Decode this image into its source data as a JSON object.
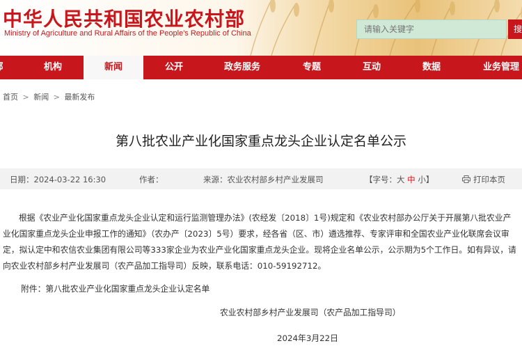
{
  "header": {
    "title_cn": "中华人民共和国农业农村部",
    "title_en": "Ministry of Agriculture and Rural Affairs of the People's Republic of China",
    "search_placeholder": "请输入关键字",
    "search_button": "搜"
  },
  "nav": {
    "items": [
      {
        "label": "部",
        "active": false
      },
      {
        "label": "机构",
        "active": false
      },
      {
        "label": "新闻",
        "active": true
      },
      {
        "label": "公开",
        "active": false
      },
      {
        "label": "政务服务",
        "active": false
      },
      {
        "label": "专题",
        "active": false
      },
      {
        "label": "互动",
        "active": false
      },
      {
        "label": "数据",
        "active": false
      },
      {
        "label": "业务管理",
        "active": false
      }
    ]
  },
  "breadcrumb": {
    "items": [
      "首页",
      "新闻",
      "最新发布"
    ],
    "separator": ">"
  },
  "article": {
    "title": "第八批农业产业化国家重点龙头企业认定名单公示",
    "date": "日期：2024-03-22 16:30",
    "author": "作者：",
    "source": "来源：农业农村部乡村产业发展司",
    "font_size_prefix": "【字号：",
    "font_large": "大",
    "font_medium": "中",
    "font_small": "小",
    "font_size_suffix": "】",
    "print": "打印本页",
    "body": "根据《农业产业化国家重点龙头企业认定和运行监测管理办法》(农经发〔2018〕1号)规定和《农业农村部办公厅关于开展第八批农业产业化国家重点龙头企业申报工作的通知》（农办产〔2023〕5号）要求，经各省（区、市）遴选推荐、专家评审和全国农业产业化联席会议审定，拟认定中和农信农业集团有限公司等333家企业为农业产业化国家重点龙头企业。现将企业名单公示，公示期为5个工作日。如有异议，请向农业农村部乡村产业发展司（农产品加工指导司）反映，联系电话：010-59192712。",
    "attachment": "附件：第八批农业产业化国家重点龙头企业认定名单",
    "signature_org": "农业农村部乡村产业发展司（农产品加工指导司）",
    "signature_date": "2024年3月22日"
  },
  "colors": {
    "brand_red": "#c8161d",
    "search_bg": "#cfe9d6",
    "meta_bg": "#f2f2f2"
  }
}
